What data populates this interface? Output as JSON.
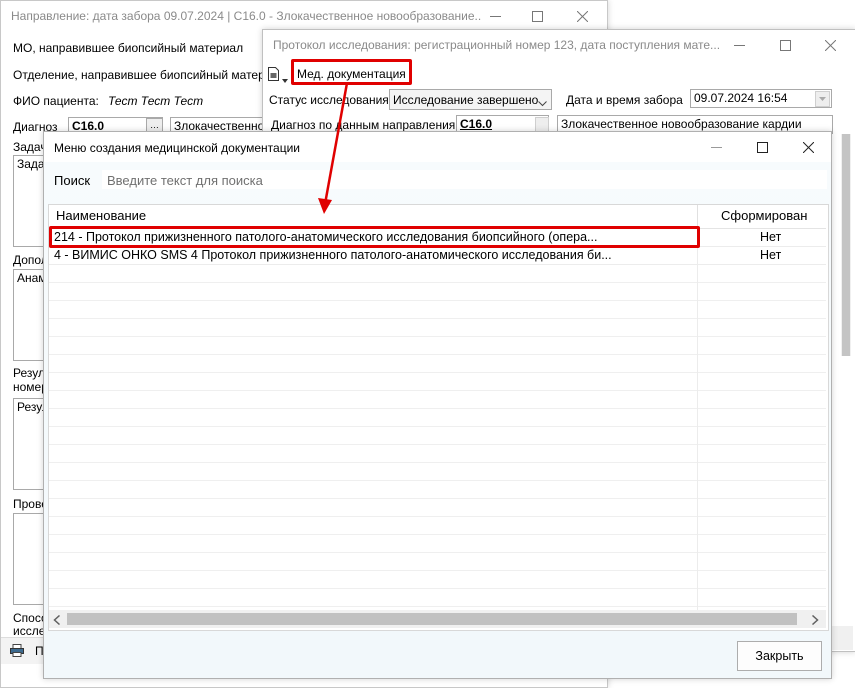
{
  "back_window": {
    "title": "Направление: дата забора 09.07.2024 | C16.0 - Злокачественное новообразование...",
    "mo_label": "МО, направившее биопсийный материал",
    "dept_label": "Отделение, направившее биопсийный материал",
    "patient_label": "ФИО пациента:",
    "patient_value": "Тест Тест Тест",
    "diagnosis_label": "Диагноз",
    "diagnosis_code": "C16.0",
    "diagnosis_text": "Злокачественное",
    "task_label": "Задач",
    "task_field": "Задач",
    "additional_label": "Допол",
    "anamnesis_field": "Анамн",
    "result_label1": "Резул",
    "result_label2": "номер",
    "result_field": "Резул",
    "check_label": "Прове",
    "method_label1": "Спосо",
    "method_label2": "иссле",
    "print_label": "П"
  },
  "protocol_window": {
    "title": "Протокол исследования: регистрационный номер 123, дата поступления мате...",
    "menu_label": "Мед. документация",
    "status_label": "Статус исследования",
    "status_value": "Исследование завершено",
    "date_label": "Дата и время забора",
    "date_value": "09.07.2024 16:54",
    "dx_label": "Диагноз по данным направления",
    "dx_code": "C16.0",
    "dx_text": "Злокачественное новообразование кардии"
  },
  "menu_dialog": {
    "title": "Меню создания медицинской документации",
    "search_label": "Поиск",
    "search_placeholder": "Введите текст для поиска",
    "columns": {
      "name": "Наименование",
      "formed": "Сформирован"
    },
    "rows": [
      {
        "name": "214 - Протокол прижизненного патолого-анатомического исследования биопсийного (опера...",
        "formed": "Нет"
      },
      {
        "name": "4 - ВИМИС ОНКО SMS 4 Протокол прижизненного патолого-анатомического исследования би...",
        "formed": "Нет"
      }
    ],
    "close_button": "Закрыть"
  },
  "annotation_color": "#e00000",
  "icons": [
    "minimize-icon",
    "maximize-icon",
    "close-icon",
    "document-icon",
    "dropdown-arrow-icon",
    "calendar-icon",
    "printer-icon",
    "scroll-left-icon",
    "scroll-right-icon"
  ]
}
